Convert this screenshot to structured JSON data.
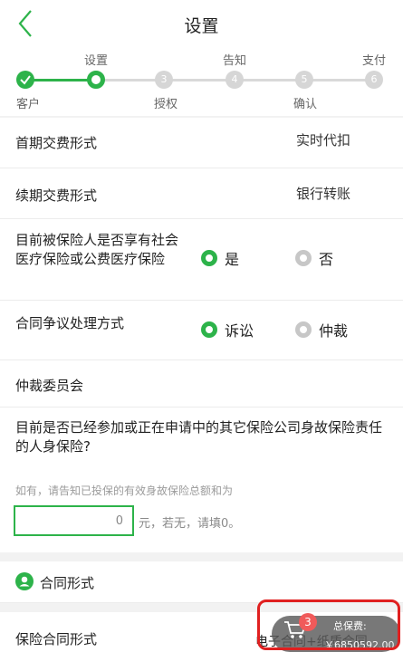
{
  "header": {
    "title": "设置",
    "back_icon": "chevron-left-icon"
  },
  "steps": [
    {
      "num": "",
      "label": "客户",
      "state": "done"
    },
    {
      "num": "",
      "label": "设置",
      "state": "current"
    },
    {
      "num": "3",
      "label": "授权",
      "state": "pending"
    },
    {
      "num": "4",
      "label": "告知",
      "state": "pending"
    },
    {
      "num": "5",
      "label": "确认",
      "state": "pending"
    },
    {
      "num": "6",
      "label": "支付",
      "state": "pending"
    }
  ],
  "form": {
    "first_payment": {
      "label": "首期交费形式",
      "value": "实时代扣"
    },
    "renewal_payment": {
      "label": "续期交费形式",
      "value": "银行转账"
    },
    "social_insurance": {
      "label": "目前被保险人是否享有社会医疗保险或公费医疗保险",
      "options": [
        {
          "label": "是",
          "selected": true
        },
        {
          "label": "否",
          "selected": false
        }
      ]
    },
    "dispute": {
      "label": "合同争议处理方式",
      "options": [
        {
          "label": "诉讼",
          "selected": true
        },
        {
          "label": "仲裁",
          "selected": false
        }
      ]
    },
    "arbitration": {
      "label": "仲裁委员会"
    },
    "other_insurance": {
      "label": "目前是否已经参加或正在申请中的其它保险公司身故保险责任的人身保险?"
    },
    "hint": "如有，请告知已投保的有效身故保险总额和为",
    "amount": {
      "value": "0",
      "suffix": "元，若无，请填0。"
    }
  },
  "section": {
    "title": "合同形式",
    "icon": "user-icon"
  },
  "contract_form": {
    "label": "保险合同形式",
    "value": "电子合同+纸质合同"
  },
  "cart": {
    "badge": "3",
    "total_label": "总保费:",
    "total_value": "￥6850592.00",
    "icon": "cart-icon"
  },
  "colors": {
    "accent": "#2db34a",
    "badge": "#f05a5a",
    "highlight": "#e02020"
  }
}
